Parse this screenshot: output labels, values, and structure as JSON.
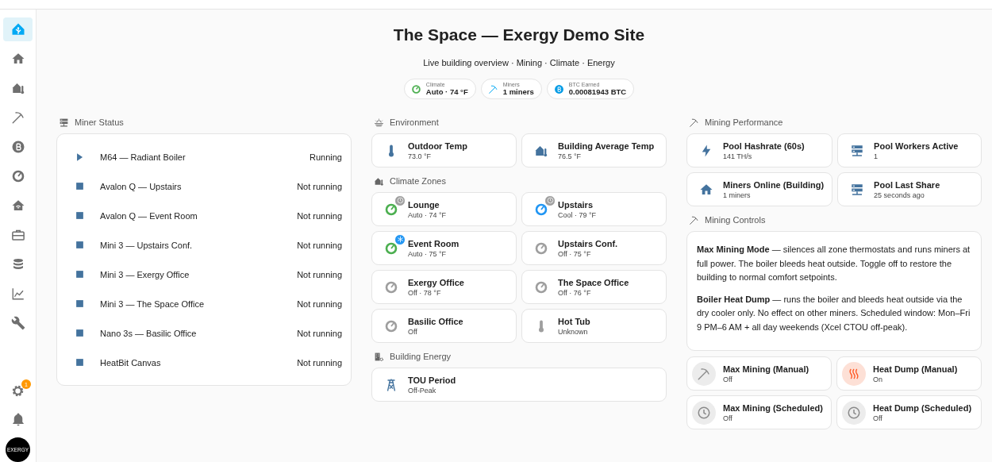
{
  "sidebar": {
    "items": [
      {
        "kind": "logo",
        "selected": true
      },
      {
        "kind": "home",
        "selected": false
      },
      {
        "kind": "home-thermo",
        "selected": false
      },
      {
        "kind": "pickaxe",
        "selected": false
      },
      {
        "kind": "bitcoin",
        "selected": false
      },
      {
        "kind": "gauge",
        "selected": false
      },
      {
        "kind": "house-wifi",
        "selected": false
      },
      {
        "kind": "briefcase",
        "selected": false
      },
      {
        "kind": "database",
        "selected": false
      },
      {
        "kind": "chart",
        "selected": false
      },
      {
        "kind": "wrench",
        "selected": false
      }
    ],
    "settings_badge": "1",
    "avatar": "EXERGY"
  },
  "header": {
    "title": "The Space — Exergy Demo Site",
    "subtitle": "Live building overview · Mining · Climate · Energy",
    "chips": [
      {
        "label": "Climate",
        "value": "Auto · 74 °F",
        "kind": "gauge",
        "color": "#4caf50"
      },
      {
        "label": "Miners",
        "value": "1 miners",
        "kind": "pickaxe",
        "color": "#03a9f4"
      },
      {
        "label": "BTC Earned",
        "value": "0.00081943 BTC",
        "kind": "bitcoin",
        "color": "#039be5"
      }
    ]
  },
  "columns": [
    [
      {
        "kind": "list",
        "title": "Miner Status",
        "rows": [
          {
            "name": "M64 — Radiant Boiler",
            "status": "Running",
            "running": true
          },
          {
            "name": "Avalon Q — Upstairs",
            "status": "Not running",
            "running": false
          },
          {
            "name": "Avalon Q — Event Room",
            "status": "Not running",
            "running": false
          },
          {
            "name": "Mini 3 — Upstairs Conf.",
            "status": "Not running",
            "running": false
          },
          {
            "name": "Mini 3 — Exergy Office",
            "status": "Not running",
            "running": false
          },
          {
            "name": "Mini 3 — The Space Office",
            "status": "Not running",
            "running": false
          },
          {
            "name": "Nano 3s — Basilic Office",
            "status": "Not running",
            "running": false
          },
          {
            "name": "HeatBit Canvas",
            "status": "Not running",
            "running": false
          }
        ]
      }
    ],
    [
      {
        "kind": "tiles",
        "title": "Environment",
        "tiles": [
          {
            "name": "Outdoor Temp",
            "state": "73.0 °F",
            "kind": "thermometer",
            "color": "#44739e"
          },
          {
            "name": "Building Average Temp",
            "state": "76.5 °F",
            "kind": "home-thermo",
            "color": "#44739e"
          }
        ]
      },
      {
        "kind": "tiles",
        "title": "Climate Zones",
        "tiles": [
          {
            "name": "Lounge",
            "state": "Auto · 74 °F",
            "kind": "gauge",
            "color": "#4caf50",
            "badge": {
              "kind": "clock",
              "color": "#9e9e9e"
            }
          },
          {
            "name": "Upstairs",
            "state": "Cool · 79 °F",
            "kind": "gauge",
            "color": "#2196f3",
            "badge": {
              "kind": "clock",
              "color": "#9e9e9e"
            }
          },
          {
            "name": "Event Room",
            "state": "Auto · 75 °F",
            "kind": "gauge",
            "color": "#4caf50",
            "badge": {
              "kind": "snowflake",
              "color": "#2196f3"
            }
          },
          {
            "name": "Upstairs Conf.",
            "state": "Off · 75 °F",
            "kind": "gauge",
            "color": "#9e9e9e"
          },
          {
            "name": "Exergy Office",
            "state": "Off · 78 °F",
            "kind": "gauge",
            "color": "#9e9e9e"
          },
          {
            "name": "The Space Office",
            "state": "Off · 76 °F",
            "kind": "gauge",
            "color": "#9e9e9e"
          },
          {
            "name": "Basilic Office",
            "state": "Off",
            "kind": "gauge",
            "color": "#9e9e9e"
          },
          {
            "name": "Hot Tub",
            "state": "Unknown",
            "kind": "thermometer",
            "color": "#9e9e9e"
          }
        ]
      },
      {
        "kind": "tiles",
        "title": "Building Energy",
        "tiles": [
          {
            "name": "TOU Period",
            "state": "Off-Peak",
            "kind": "tower",
            "color": "#44739e"
          }
        ]
      }
    ],
    [
      {
        "kind": "tiles",
        "title": "Mining Performance",
        "tiles": [
          {
            "name": "Pool Hashrate (60s)",
            "state": "141 TH/s",
            "kind": "bolt",
            "color": "#44739e"
          },
          {
            "name": "Pool Workers Active",
            "state": "1",
            "kind": "server",
            "color": "#44739e"
          },
          {
            "name": "Miners Online (Building)",
            "state": "1 miners",
            "kind": "home",
            "color": "#44739e"
          },
          {
            "name": "Pool Last Share",
            "state": "25 seconds ago",
            "kind": "server",
            "color": "#44739e"
          }
        ]
      },
      {
        "kind": "controls",
        "title": "Mining Controls",
        "paragraphs": [
          "**Max Mining Mode** — silences all zone thermostats and runs miners at full power. The boiler bleeds heat outside. Toggle off to restore the building to normal comfort setpoints.",
          "**Boiler Heat Dump** — runs the boiler and bleeds heat outside via the dry cooler only. No effect on other miners. Scheduled window: Mon–Fri 9 PM–6 AM + all day weekends (Xcel CTOU off-peak)."
        ],
        "tiles": [
          {
            "name": "Max Mining (Manual)",
            "state": "Off",
            "kind": "pickaxe",
            "on": false
          },
          {
            "name": "Heat Dump (Manual)",
            "state": "On",
            "kind": "heat-waves",
            "on": true
          },
          {
            "name": "Max Mining (Scheduled)",
            "state": "Off",
            "kind": "clock",
            "on": false
          },
          {
            "name": "Heat Dump (Scheduled)",
            "state": "Off",
            "kind": "clock",
            "on": false
          }
        ]
      }
    ]
  ]
}
